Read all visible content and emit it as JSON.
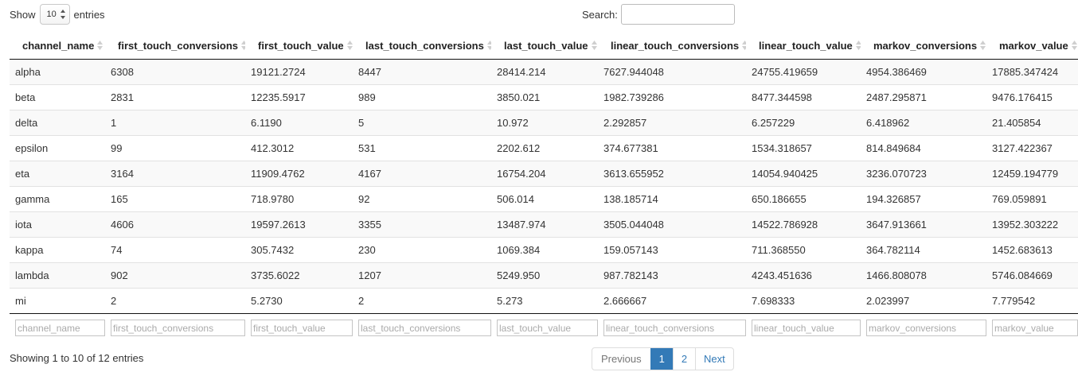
{
  "controls": {
    "length_prefix": "Show",
    "length_value": "10",
    "length_suffix": "entries",
    "search_label": "Search:",
    "search_value": ""
  },
  "table": {
    "columns": [
      "channel_name",
      "first_touch_conversions",
      "first_touch_value",
      "last_touch_conversions",
      "last_touch_value",
      "linear_touch_conversions",
      "linear_touch_value",
      "markov_conversions",
      "markov_value"
    ],
    "rows": [
      [
        "alpha",
        "6308",
        "19121.2724",
        "8447",
        "28414.214",
        "7627.944048",
        "24755.419659",
        "4954.386469",
        "17885.347424"
      ],
      [
        "beta",
        "2831",
        "12235.5917",
        "989",
        "3850.021",
        "1982.739286",
        "8477.344598",
        "2487.295871",
        "9476.176415"
      ],
      [
        "delta",
        "1",
        "6.1190",
        "5",
        "10.972",
        "2.292857",
        "6.257229",
        "6.418962",
        "21.405854"
      ],
      [
        "epsilon",
        "99",
        "412.3012",
        "531",
        "2202.612",
        "374.677381",
        "1534.318657",
        "814.849684",
        "3127.422367"
      ],
      [
        "eta",
        "3164",
        "11909.4762",
        "4167",
        "16754.204",
        "3613.655952",
        "14054.940425",
        "3236.070723",
        "12459.194779"
      ],
      [
        "gamma",
        "165",
        "718.9780",
        "92",
        "506.014",
        "138.185714",
        "650.186655",
        "194.326857",
        "769.059891"
      ],
      [
        "iota",
        "4606",
        "19597.2613",
        "3355",
        "13487.974",
        "3505.044048",
        "14522.786928",
        "3647.913661",
        "13952.303222"
      ],
      [
        "kappa",
        "74",
        "305.7432",
        "230",
        "1069.384",
        "159.057143",
        "711.368550",
        "364.782114",
        "1452.683613"
      ],
      [
        "lambda",
        "902",
        "3735.6022",
        "1207",
        "5249.950",
        "987.782143",
        "4243.451636",
        "1466.808078",
        "5746.084669"
      ],
      [
        "mi",
        "2",
        "5.2730",
        "2",
        "5.273",
        "2.666667",
        "7.698333",
        "2.023997",
        "7.779542"
      ]
    ],
    "filter_placeholders": [
      "channel_name",
      "first_touch_conversions",
      "first_touch_value",
      "last_touch_conversions",
      "last_touch_value",
      "linear_touch_conversions",
      "linear_touch_value",
      "markov_conversions",
      "markov_value"
    ]
  },
  "footer": {
    "info": "Showing 1 to 10 of 12 entries",
    "pagination": {
      "previous": "Previous",
      "pages": [
        "1",
        "2"
      ],
      "active_page": "1",
      "next": "Next"
    }
  },
  "colors": {
    "accent": "#337ab7",
    "stripe": "#f9f9f9",
    "border": "#dddddd"
  },
  "icons": {
    "sort": "sort-both-icon",
    "select_arrows": "updown-arrows-icon"
  }
}
